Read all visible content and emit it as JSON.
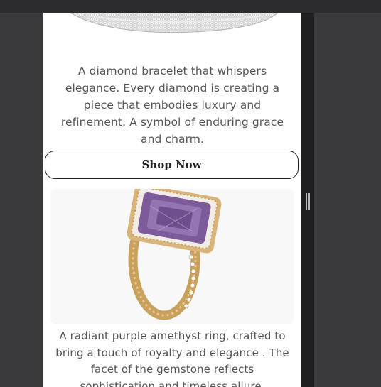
{
  "products": [
    {
      "image": "diamond-bracelet-image",
      "description": "A diamond bracelet that whispers elegance. Every diamond is creating a piece that embodies luxury and refinement. A symbol of enduring grace and charm.",
      "button_label": "Shop Now"
    },
    {
      "image": "amethyst-ring-image",
      "description": "A radiant purple amethyst ring, crafted to bring a touch of royalty and elegance . The facet of the gemstone reflects sophistication and timeless allure."
    }
  ],
  "colors": {
    "amethyst": "#7d5a9a",
    "gold": "#c9a15d",
    "button_border": "#222222"
  }
}
